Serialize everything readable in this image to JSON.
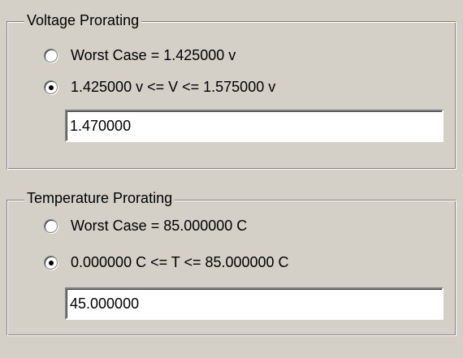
{
  "voltage": {
    "title": "Voltage Prorating",
    "options": [
      {
        "label": "Worst Case = 1.425000 v",
        "selected": false
      },
      {
        "label": "1.425000 v <= V <= 1.575000 v",
        "selected": true
      }
    ],
    "value": "1.470000"
  },
  "temperature": {
    "title": "Temperature Prorating",
    "options": [
      {
        "label": "Worst Case = 85.000000 C",
        "selected": false
      },
      {
        "label": "0.000000 C <= T <= 85.000000 C",
        "selected": true
      }
    ],
    "value": "45.000000"
  }
}
